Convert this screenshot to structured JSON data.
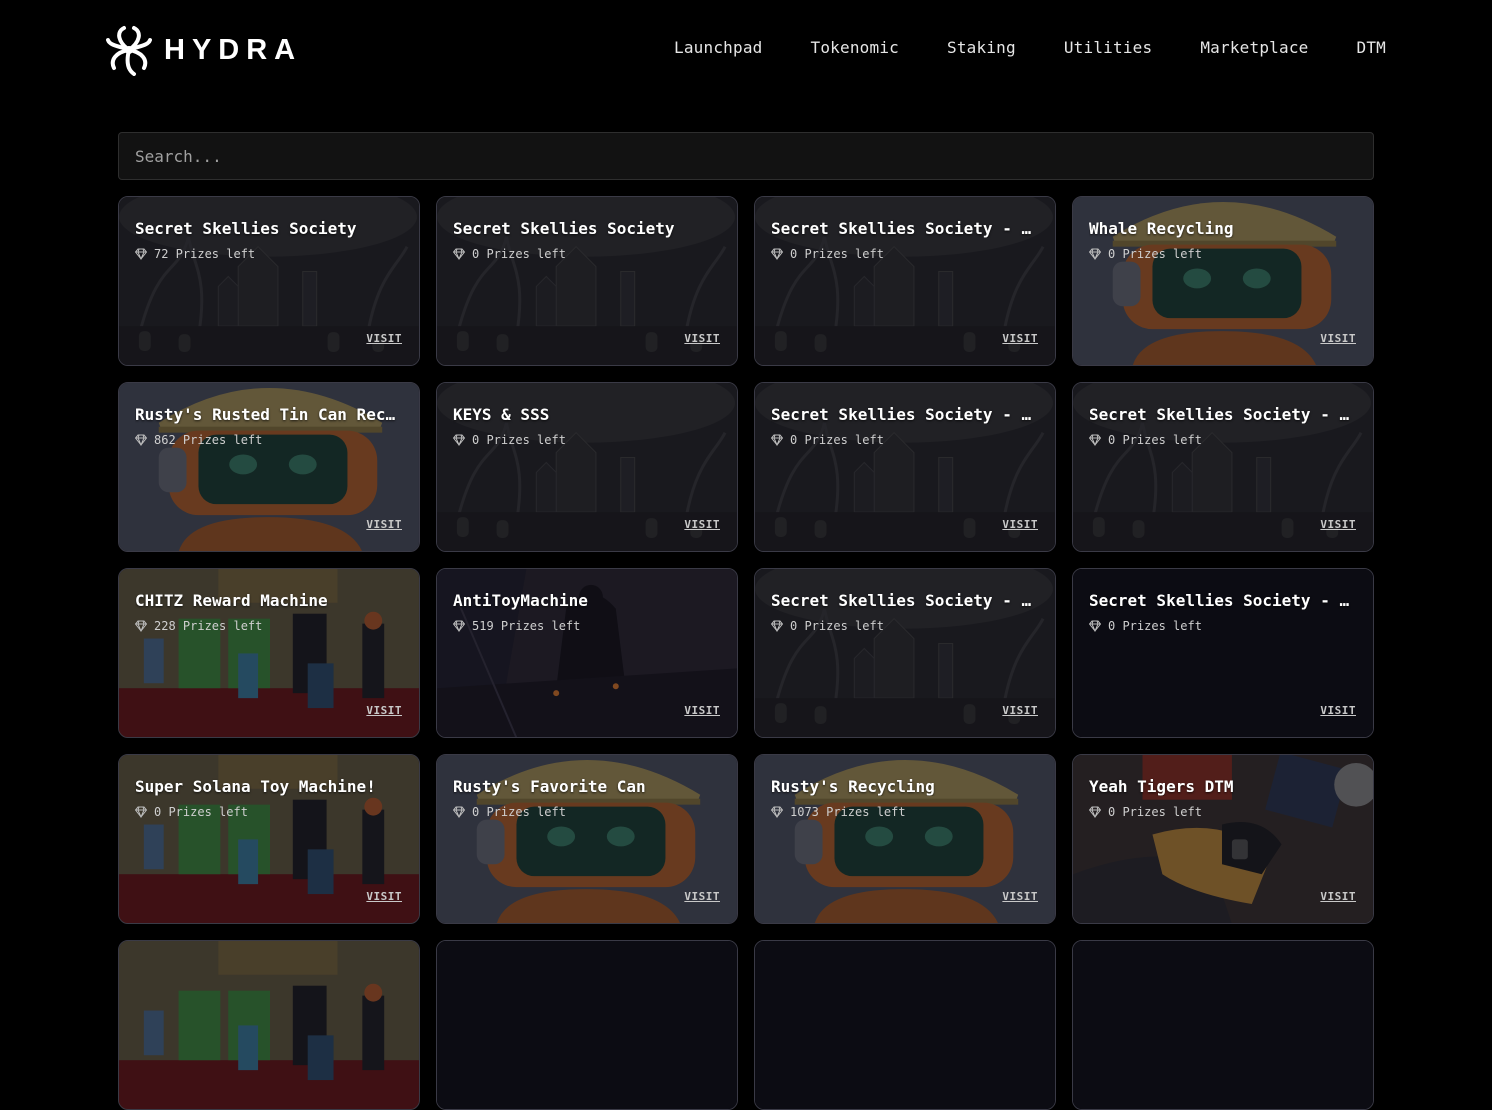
{
  "header": {
    "logo_text": "HYDRA",
    "nav": [
      "Launchpad",
      "Tokenomic",
      "Staking",
      "Utilities",
      "Marketplace",
      "DTM"
    ]
  },
  "search": {
    "placeholder": "Search...",
    "value": ""
  },
  "colors": {
    "background": "#000000",
    "card_border": "#3a3a46",
    "search_bg": "#121212"
  },
  "cards": [
    {
      "title": "Secret Skellies Society",
      "prizes": "72 Prizes left",
      "visit": "VISIT",
      "art": "graveyard"
    },
    {
      "title": "Secret Skellies Society",
      "prizes": "0 Prizes left",
      "visit": "VISIT",
      "art": "graveyard"
    },
    {
      "title": "Secret Skellies Society - …",
      "prizes": "0 Prizes left",
      "visit": "VISIT",
      "art": "graveyard"
    },
    {
      "title": "Whale Recycling",
      "prizes": "0 Prizes left",
      "visit": "VISIT",
      "art": "robot"
    },
    {
      "title": "Rusty's Rusted Tin Can Rec…",
      "prizes": "862 Prizes left",
      "visit": "VISIT",
      "art": "robot"
    },
    {
      "title": "KEYS & SSS",
      "prizes": "0 Prizes left",
      "visit": "VISIT",
      "art": "graveyard"
    },
    {
      "title": "Secret Skellies Society - …",
      "prizes": "0 Prizes left",
      "visit": "VISIT",
      "art": "graveyard"
    },
    {
      "title": "Secret Skellies Society - …",
      "prizes": "0 Prizes left",
      "visit": "VISIT",
      "art": "graveyard"
    },
    {
      "title": "CHITZ Reward Machine",
      "prizes": "228 Prizes left",
      "visit": "VISIT",
      "art": "foxclub"
    },
    {
      "title": "AntiToyMachine",
      "prizes": "519 Prizes left",
      "visit": "VISIT",
      "art": "antitoy"
    },
    {
      "title": "Secret Skellies Society - …",
      "prizes": "0 Prizes left",
      "visit": "VISIT",
      "art": "graveyard"
    },
    {
      "title": "Secret Skellies Society - …",
      "prizes": "0 Prizes left",
      "visit": "VISIT",
      "art": "plain"
    },
    {
      "title": "Super Solana Toy Machine!",
      "prizes": "0 Prizes left",
      "visit": "VISIT",
      "art": "foxclub"
    },
    {
      "title": "Rusty's Favorite Can",
      "prizes": "0 Prizes left",
      "visit": "VISIT",
      "art": "robot"
    },
    {
      "title": "Rusty's Recycling",
      "prizes": "1073 Prizes left",
      "visit": "VISIT",
      "art": "robot"
    },
    {
      "title": "Yeah Tigers DTM",
      "prizes": "0 Prizes left",
      "visit": "VISIT",
      "art": "tigers"
    },
    {
      "title": "",
      "prizes": "",
      "visit": "",
      "art": "foxclub"
    },
    {
      "title": "",
      "prizes": "",
      "visit": "",
      "art": "plain"
    },
    {
      "title": "",
      "prizes": "",
      "visit": "",
      "art": "plain"
    },
    {
      "title": "",
      "prizes": "",
      "visit": "",
      "art": "plain"
    }
  ]
}
